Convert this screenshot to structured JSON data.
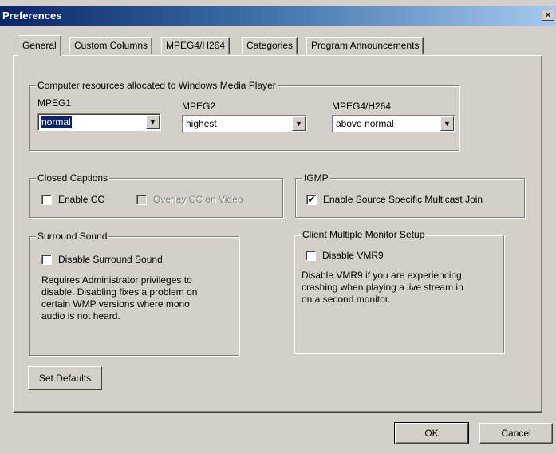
{
  "window": {
    "title": "Preferences",
    "close_glyph": "×",
    "close_icon": "close-icon"
  },
  "tabs": [
    {
      "label": "General",
      "active": true
    },
    {
      "label": "Custom Columns",
      "active": false
    },
    {
      "label": "MPEG4/H264",
      "active": false
    },
    {
      "label": "Categories",
      "active": false
    },
    {
      "label": "Program Announcements",
      "active": false
    }
  ],
  "resources": {
    "legend": "Computer resources allocated to Windows Media Player",
    "mpeg1": {
      "label": "MPEG1",
      "value": "normal"
    },
    "mpeg2": {
      "label": "MPEG2",
      "value": "highest"
    },
    "mpeg4": {
      "label": "MPEG4/H264",
      "value": "above normal"
    },
    "dropdown_glyph": "▼"
  },
  "closed_captions": {
    "legend": "Closed Captions",
    "enable_cc": {
      "label": "Enable CC",
      "checked": false
    },
    "overlay_cc": {
      "label": "Overlay CC on Video",
      "checked": false,
      "disabled": true
    }
  },
  "igmp": {
    "legend": "IGMP",
    "ssm_join": {
      "label": "Enable Source Specific Multicast Join",
      "checked": true,
      "mark": "✔"
    }
  },
  "surround": {
    "legend": "Surround Sound",
    "disable_surround": {
      "label": "Disable Surround Sound",
      "checked": false
    },
    "note_lines": [
      "Requires Administrator privileges to",
      "disable.  Disabling fixes a problem on",
      "certain WMP versions where mono",
      "audio is not heard."
    ]
  },
  "monitor": {
    "legend": "Client Multiple Monitor Setup",
    "disable_vmr9": {
      "label": "Disable VMR9",
      "checked": false
    },
    "note_lines": [
      "Disable VMR9 if you are experiencing",
      "crashing when playing a live stream in",
      "on a second monitor."
    ]
  },
  "buttons": {
    "set_defaults": "Set Defaults",
    "ok": "OK",
    "cancel": "Cancel"
  },
  "colors": {
    "face": "#d4d0c8",
    "titlebar": "#0a246a",
    "selection": "#0a246a"
  }
}
